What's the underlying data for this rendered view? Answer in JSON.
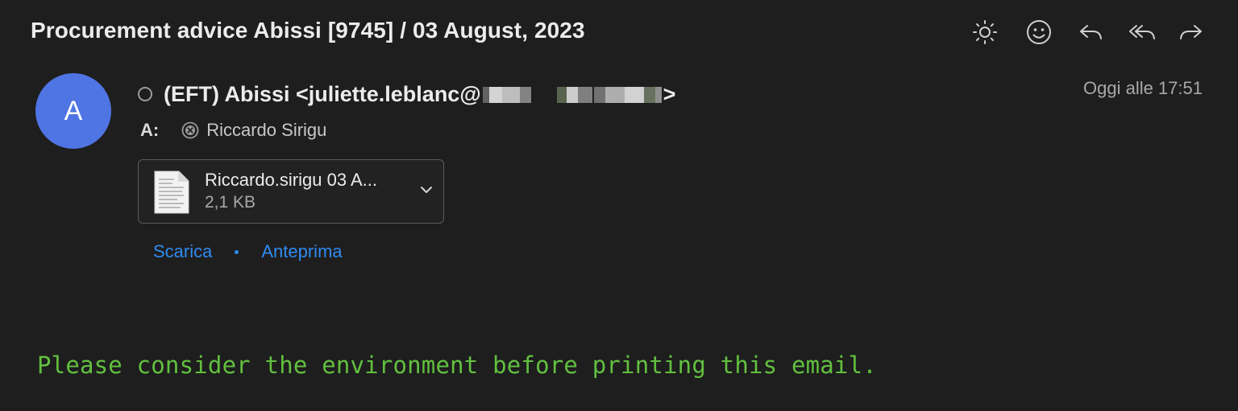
{
  "email": {
    "subject": "Procurement advice Abissi [9745] / 03 August, 2023",
    "sender": {
      "avatar_letter": "A",
      "display": "(EFT) Abissi <juliette.leblanc@",
      "display_tail": ">"
    },
    "date": "Oggi alle 17:51",
    "to": {
      "label": "A:",
      "recipient": "Riccardo Sirigu"
    },
    "attachment": {
      "name": "Riccardo.sirigu 03 A...",
      "size": "2,1 KB"
    },
    "actions": {
      "download": "Scarica",
      "preview": "Anteprima"
    },
    "footer": "Please consider the environment before printing this email."
  },
  "toolbar": {
    "icons": [
      "brightness-icon",
      "emoji-icon",
      "reply-icon",
      "reply-all-icon",
      "forward-icon"
    ]
  },
  "colors": {
    "background": "#1e1e1e",
    "avatar": "#4f74e3",
    "link": "#2f8bf0",
    "footer_text": "#62c03f"
  }
}
